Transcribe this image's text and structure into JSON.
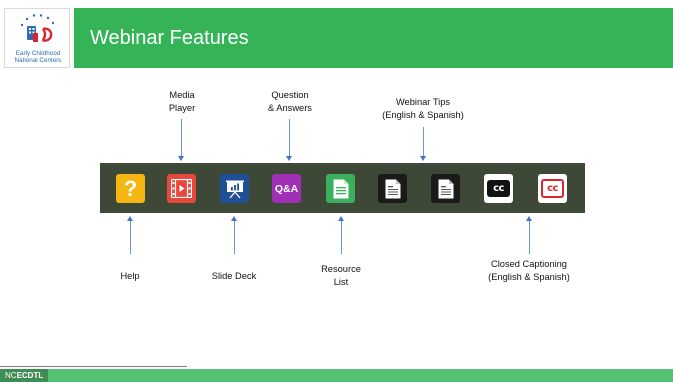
{
  "header": {
    "logo_line1": "Early Childhood",
    "logo_line2": "National Centers",
    "title": "Webinar Features"
  },
  "callouts": {
    "media_player": "Media\nPlayer",
    "questions": "Question\n& Answers",
    "webinar_tips": "Webinar Tips\n(English & Spanish)",
    "help": "Help",
    "slide_deck": "Slide Deck",
    "resource_list": "Resource\nList",
    "closed_captioning": "Closed Captioning\n(English & Spanish)"
  },
  "toolbar": {
    "icons": [
      "help-icon",
      "media-player-icon",
      "slide-deck-icon",
      "qa-icon",
      "resource-list-icon",
      "webinar-tip-english-icon",
      "webinar-tip-spanish-icon",
      "closed-caption-icon",
      "closed-caption-spanish-icon"
    ],
    "help_glyph": "?",
    "qa_label": "Q&A",
    "cc_label": "cc"
  },
  "footer": {
    "tag_prefix": "NC",
    "tag_bold": "ECDTL"
  },
  "colors": {
    "header_green": "#34b357",
    "toolbar_bg": "#3d4836",
    "help": "#f5b611",
    "media": "#e8473c",
    "slide": "#1f4f96",
    "qa": "#9f2fb5",
    "resource": "#3aaf5c",
    "tip": "#1a1a1a",
    "cc_red": "#d9252f",
    "arrow_blue": "#4472c4"
  }
}
